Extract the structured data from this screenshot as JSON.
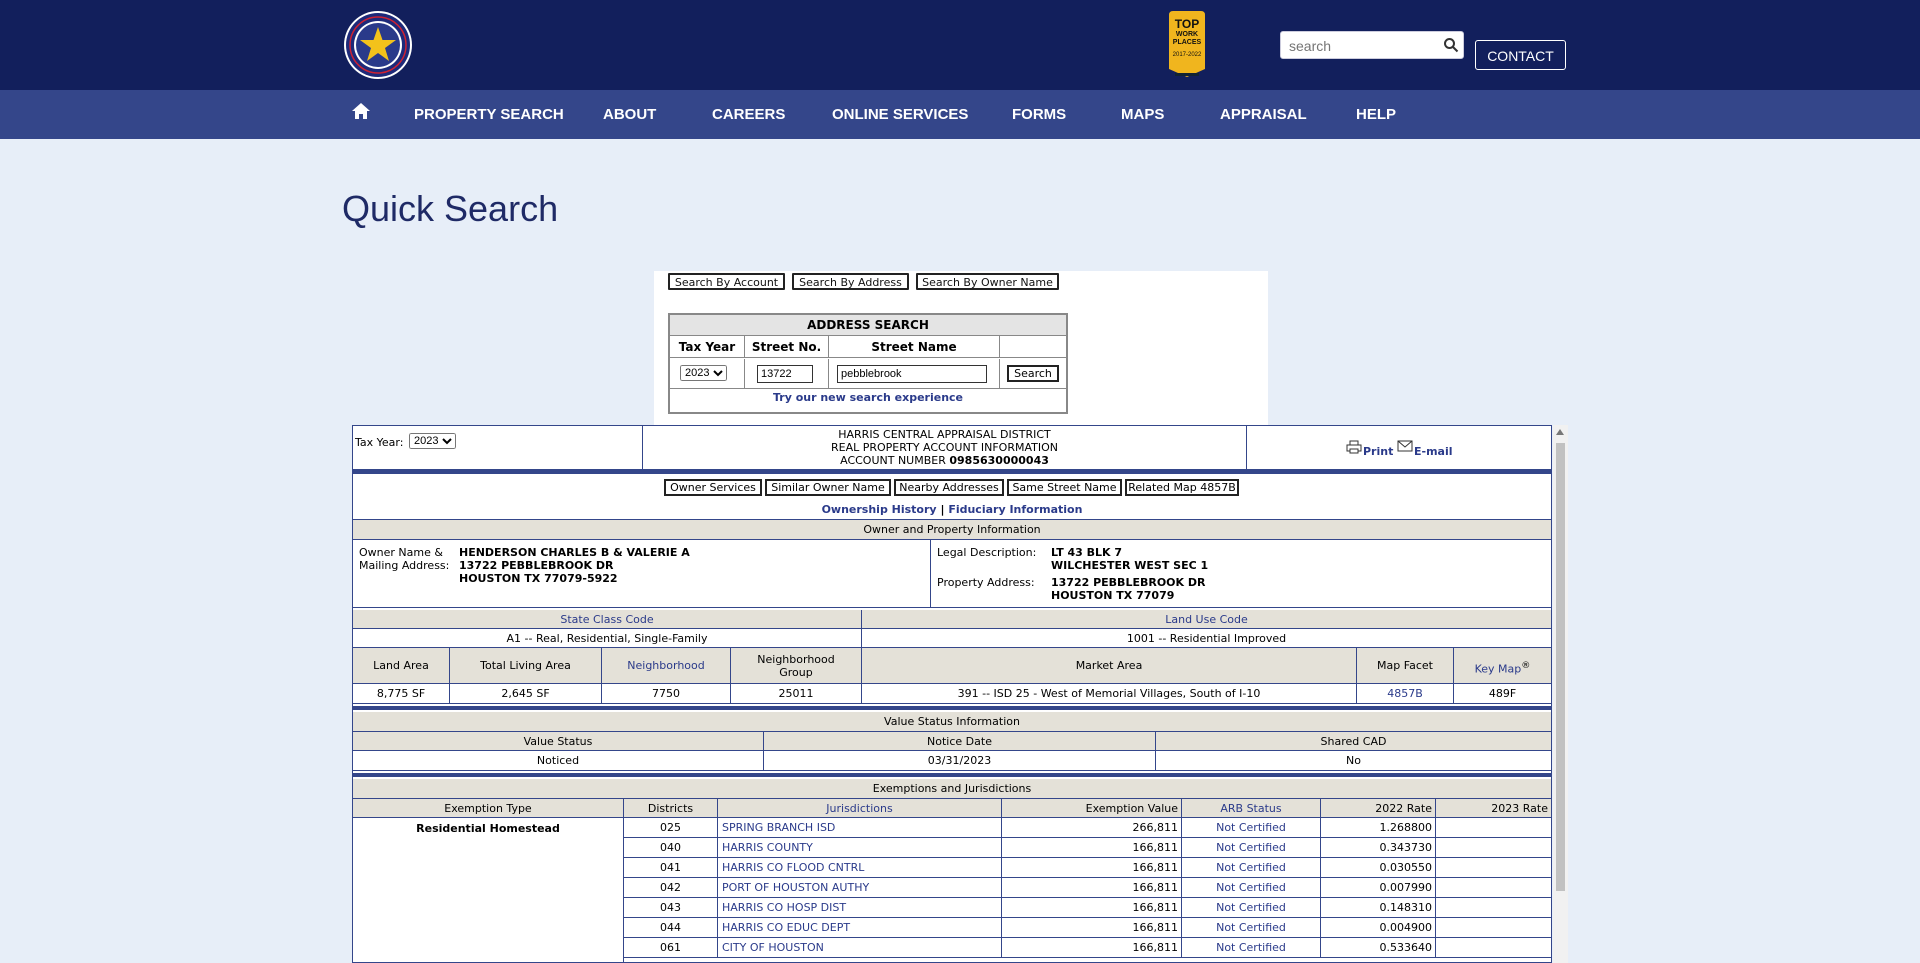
{
  "header": {
    "search_placeholder": "search",
    "contact_label": "CONTACT",
    "award_top": "TOP",
    "award_mid": "WORK PLACES",
    "award_years": "2017-2022"
  },
  "nav": [
    "PROPERTY SEARCH",
    "ABOUT",
    "CAREERS",
    "ONLINE SERVICES",
    "FORMS",
    "MAPS",
    "APPRAISAL",
    "HELP"
  ],
  "page_title": "Quick Search",
  "quick_search": {
    "buttons": [
      "Search By Account",
      "Search By Address",
      "Search By Owner Name"
    ],
    "address_search_title": "ADDRESS SEARCH",
    "col_tax_year": "Tax Year",
    "col_street_no": "Street No.",
    "col_street_name": "Street Name",
    "tax_year": "2023",
    "street_no": "13722",
    "street_name": "pebblebrook",
    "search_button": "Search",
    "try_link": "Try our new search experience"
  },
  "account": {
    "tax_year_label": "Tax Year:",
    "tax_year": "2023",
    "district": "HARRIS CENTRAL APPRAISAL DISTRICT",
    "info": "REAL PROPERTY ACCOUNT INFORMATION",
    "account_number_label": "ACCOUNT NUMBER",
    "account_number": "0985630000043",
    "print": "Print",
    "email": "E-mail",
    "tools": [
      "Owner Services",
      "Similar Owner Name",
      "Nearby Addresses",
      "Same Street Name",
      "Related Map 4857B"
    ],
    "ownership_history": "Ownership History",
    "divider": "|",
    "fiduciary": "Fiduciary Information",
    "owner_section": "Owner and Property Information",
    "owner_label": "Owner Name &",
    "mailing_label": "Mailing Address:",
    "owner_lines": [
      "HENDERSON CHARLES B & VALERIE A",
      "13722 PEBBLEBROOK DR",
      "HOUSTON TX 77079-5922"
    ],
    "legal_label": "Legal Description:",
    "legal_lines": [
      "LT 43 BLK 7",
      "WILCHESTER WEST SEC 1"
    ],
    "property_label": "Property Address:",
    "property_lines": [
      "13722 PEBBLEBROOK DR",
      "HOUSTON TX 77079"
    ],
    "state_class_label": "State Class Code",
    "state_class": "A1 -- Real, Residential, Single-Family",
    "land_use_label": "Land Use Code",
    "land_use": "1001 -- Residential Improved",
    "land_area_label": "Land Area",
    "living_area_label": "Total Living Area",
    "neighborhood_label": "Neighborhood",
    "nbhd_group_label_1": "Neighborhood",
    "nbhd_group_label_2": "Group",
    "market_area_label": "Market Area",
    "map_facet_label": "Map Facet",
    "key_map_label": "Key Map",
    "key_map_sup": "®",
    "land_area": "8,775 SF",
    "living_area": "2,645 SF",
    "neighborhood": "7750",
    "nbhd_group": "25011",
    "market_area": "391 -- ISD 25 - West of Memorial Villages, South of I-10",
    "map_facet": "4857B",
    "key_map": "489F",
    "value_status_section": "Value Status Information",
    "value_status_label": "Value Status",
    "notice_date_label": "Notice Date",
    "shared_cad_label": "Shared CAD",
    "value_status": "Noticed",
    "notice_date": "03/31/2023",
    "shared_cad": "No",
    "exemptions_section": "Exemptions and Jurisdictions",
    "ex_cols": [
      "Exemption Type",
      "Districts",
      "Jurisdictions",
      "Exemption Value",
      "ARB Status",
      "2022 Rate",
      "2023 Rate"
    ],
    "exemption_type": "Residential Homestead",
    "jurisdictions": [
      {
        "district": "025",
        "name": "SPRING BRANCH ISD",
        "value": "266,811",
        "arb": "Not Certified",
        "rate2022": "1.268800",
        "rate2023": ""
      },
      {
        "district": "040",
        "name": "HARRIS COUNTY",
        "value": "166,811",
        "arb": "Not Certified",
        "rate2022": "0.343730",
        "rate2023": ""
      },
      {
        "district": "041",
        "name": "HARRIS CO FLOOD CNTRL",
        "value": "166,811",
        "arb": "Not Certified",
        "rate2022": "0.030550",
        "rate2023": ""
      },
      {
        "district": "042",
        "name": "PORT OF HOUSTON AUTHY",
        "value": "166,811",
        "arb": "Not Certified",
        "rate2022": "0.007990",
        "rate2023": ""
      },
      {
        "district": "043",
        "name": "HARRIS CO HOSP DIST",
        "value": "166,811",
        "arb": "Not Certified",
        "rate2022": "0.148310",
        "rate2023": ""
      },
      {
        "district": "044",
        "name": "HARRIS CO EDUC DEPT",
        "value": "166,811",
        "arb": "Not Certified",
        "rate2022": "0.004900",
        "rate2023": ""
      },
      {
        "district": "061",
        "name": "CITY OF HOUSTON",
        "value": "166,811",
        "arb": "Not Certified",
        "rate2022": "0.533640",
        "rate2023": ""
      }
    ]
  }
}
